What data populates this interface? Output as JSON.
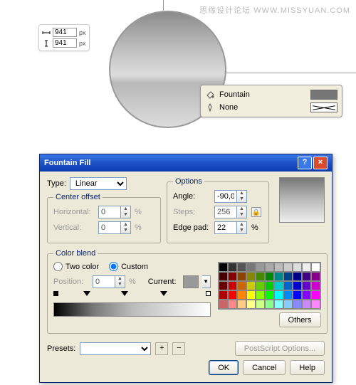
{
  "watermark": "思缘设计论坛  WWW.MISSYUAN.COM",
  "dimensions": {
    "w": "941",
    "w_unit": "px",
    "h": "941",
    "h_unit": "px"
  },
  "fill_panel": {
    "fill_label": "Fountain",
    "outline_label": "None"
  },
  "dialog": {
    "title": "Fountain Fill",
    "type_label": "Type:",
    "type_value": "Linear",
    "center_offset_legend": "Center offset",
    "horizontal_label": "Horizontal:",
    "horizontal_value": "0",
    "vertical_label": "Vertical:",
    "vertical_value": "0",
    "options_legend": "Options",
    "angle_label": "Angle:",
    "angle_value": "-90,0",
    "steps_label": "Steps:",
    "steps_value": "256",
    "edgepad_label": "Edge pad:",
    "edgepad_value": "22",
    "pct": "%",
    "blend_legend": "Color blend",
    "twocolor_label": "Two color",
    "custom_label": "Custom",
    "position_label": "Position:",
    "position_value": "0",
    "current_label": "Current:",
    "others_label": "Others",
    "presets_label": "Presets:",
    "postscript_label": "PostScript Options...",
    "ok": "OK",
    "cancel": "Cancel",
    "help": "Help",
    "palette": [
      "#000",
      "#333",
      "#555",
      "#777",
      "#999",
      "#aaa",
      "#bbb",
      "#ccc",
      "#ddd",
      "#eee",
      "#fff",
      "#400",
      "#800",
      "#840",
      "#880",
      "#480",
      "#080",
      "#088",
      "#048",
      "#008",
      "#408",
      "#808",
      "#600",
      "#c00",
      "#c60",
      "#cc0",
      "#6c0",
      "#0c0",
      "#0cc",
      "#06c",
      "#00c",
      "#60c",
      "#c0c",
      "#a00",
      "#f00",
      "#f80",
      "#ff0",
      "#8f0",
      "#0f0",
      "#0ff",
      "#08f",
      "#00f",
      "#80f",
      "#f0f",
      "#c66",
      "#f88",
      "#fc8",
      "#ff8",
      "#cf8",
      "#8f8",
      "#8ff",
      "#8cf",
      "#88f",
      "#c8f",
      "#f8f"
    ]
  }
}
